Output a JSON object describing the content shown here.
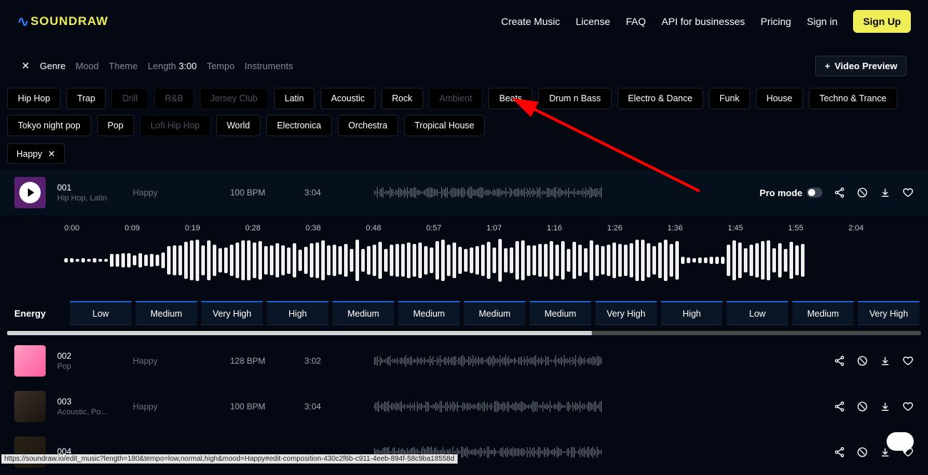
{
  "logo": {
    "text": "SOUNDRAW"
  },
  "nav": {
    "items": [
      "Create Music",
      "License",
      "FAQ",
      "API for businesses",
      "Pricing",
      "Sign in"
    ],
    "signup": "Sign Up"
  },
  "filters": {
    "tabs": {
      "genre": "Genre",
      "mood": "Mood",
      "theme": "Theme",
      "length": "Length",
      "length_val": "3:00",
      "tempo": "Tempo",
      "instruments": "Instruments"
    },
    "video_btn": "Video Preview"
  },
  "genres": [
    {
      "label": "Hip Hop",
      "dim": false
    },
    {
      "label": "Trap",
      "dim": false
    },
    {
      "label": "Drill",
      "dim": true
    },
    {
      "label": "R&B",
      "dim": true
    },
    {
      "label": "Jersey Club",
      "dim": true
    },
    {
      "label": "Latin",
      "dim": false
    },
    {
      "label": "Acoustic",
      "dim": false
    },
    {
      "label": "Rock",
      "dim": false
    },
    {
      "label": "Ambient",
      "dim": true
    },
    {
      "label": "Beats",
      "dim": false
    },
    {
      "label": "Drum n Bass",
      "dim": false
    },
    {
      "label": "Electro & Dance",
      "dim": false
    },
    {
      "label": "Funk",
      "dim": false
    },
    {
      "label": "House",
      "dim": false
    },
    {
      "label": "Techno & Trance",
      "dim": false
    },
    {
      "label": "Tokyo night pop",
      "dim": false
    },
    {
      "label": "Pop",
      "dim": false
    },
    {
      "label": "Lofi Hip Hop",
      "dim": true
    },
    {
      "label": "World",
      "dim": false
    },
    {
      "label": "Electronica",
      "dim": false
    },
    {
      "label": "Orchestra",
      "dim": false
    },
    {
      "label": "Tropical House",
      "dim": false
    }
  ],
  "selected_mood": "Happy",
  "tracks": [
    {
      "id": "001",
      "sub": "Hip Hop, Latin",
      "mood": "Happy",
      "bpm": "100 BPM",
      "dur": "3:04",
      "expanded": true
    },
    {
      "id": "002",
      "sub": "Pop",
      "mood": "Happy",
      "bpm": "128 BPM",
      "dur": "3:02",
      "expanded": false
    },
    {
      "id": "003",
      "sub": "Acoustic, Po...",
      "mood": "Happy",
      "bpm": "100 BPM",
      "dur": "3:04",
      "expanded": false
    },
    {
      "id": "004",
      "sub": "",
      "mood": "",
      "bpm": "",
      "dur": "",
      "expanded": false
    }
  ],
  "promode": "Pro mode",
  "timeline": [
    "0:00",
    "0:09",
    "0:19",
    "0:28",
    "0:38",
    "0:48",
    "0:57",
    "1:07",
    "1:16",
    "1:26",
    "1:36",
    "1:45",
    "1:55",
    "2:04"
  ],
  "energy_label": "Energy",
  "energy": [
    "Low",
    "Medium",
    "Very High",
    "High",
    "Medium",
    "Medium",
    "Medium",
    "Medium",
    "Very High",
    "High",
    "Low",
    "Medium",
    "Very High"
  ],
  "status_url": "https://soundraw.io/edit_music?length=180&tempo=low,normal,high&mood=Happy#edit-composition-430c2f6b-c911-4eeb-894f-58c9ba18558d"
}
